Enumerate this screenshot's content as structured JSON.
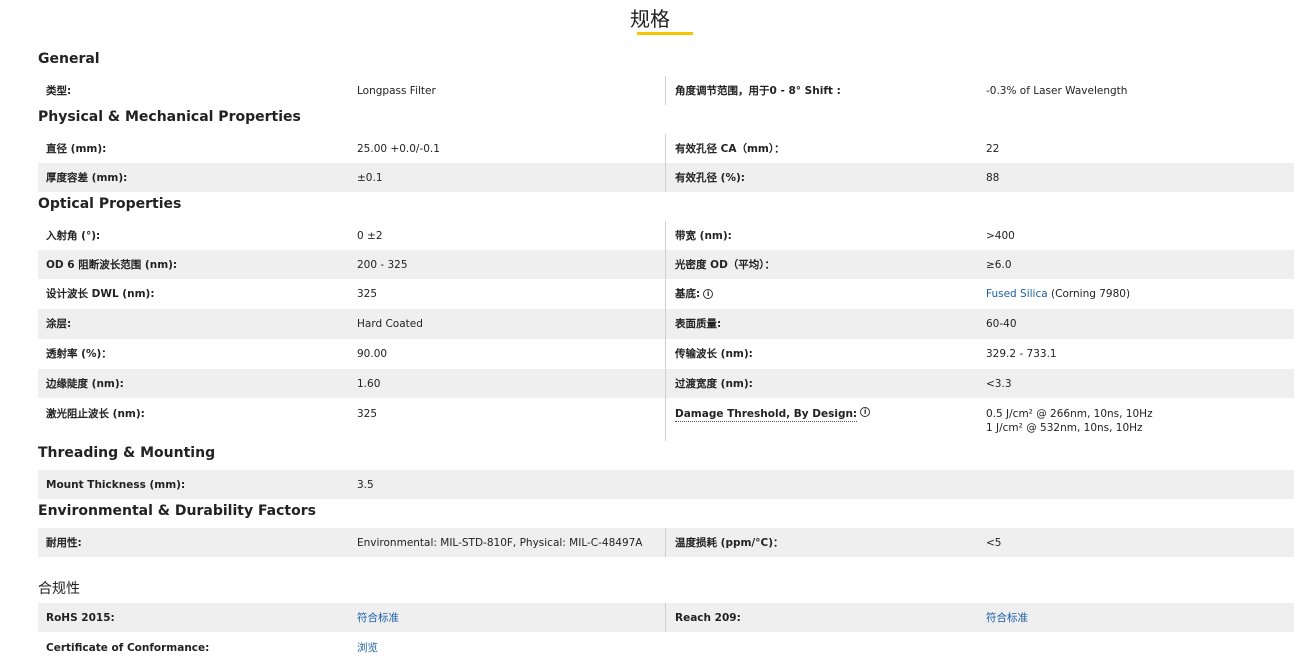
{
  "header": {
    "title": "规格"
  },
  "sections": {
    "general": "General",
    "physical": "Physical & Mechanical Properties",
    "optical": "Optical Properties",
    "threading": "Threading & Mounting",
    "environmental": "Environmental & Durability Factors",
    "compliance": "合规性"
  },
  "general": {
    "type_label": "类型:",
    "type_value": "Longpass Filter",
    "shift_label": "角度调节范围，用于0 - 8° Shift :",
    "shift_value": "-0.3% of Laser Wavelength"
  },
  "physical": {
    "diameter_label": "直径 (mm):",
    "diameter_value": "25.00 +0.0/-0.1",
    "ca_label": "有效孔径 CA（mm）：",
    "ca_value": "22",
    "thickness_tol_label": "厚度容差 (mm):",
    "thickness_tol_value": "±0.1",
    "ca_pct_label": "有效孔径 (%):",
    "ca_pct_value": "88"
  },
  "optical": {
    "aoi_label": "入射角 (°):",
    "aoi_value": "0 ±2",
    "bandwidth_label": "带宽 (nm):",
    "bandwidth_value": ">400",
    "od_range_label": "OD 6 阻断波长范围 (nm):",
    "od_range_value": "200 - 325",
    "od_label": "光密度 OD（平均）：",
    "od_value": "≥6.0",
    "dwl_label": "设计波长 DWL (nm):",
    "dwl_value": "325",
    "substrate_label": "基底:",
    "substrate_link": "Fused Silica",
    "substrate_rest": " (Corning 7980)",
    "coating_label": "涂层:",
    "coating_value": "Hard Coated",
    "surface_label": "表面质量:",
    "surface_value": "60-40",
    "trans_label": "透射率 (%)：",
    "trans_value": "90.00",
    "trans_wl_label": "传输波长 (nm):",
    "trans_wl_value": "329.2 - 733.1",
    "edge_label": "边缘陡度 (nm):",
    "edge_value": "1.60",
    "transition_label": "过渡宽度 (nm):",
    "transition_value": "<3.3",
    "blocking_label": "激光阻止波长 (nm):",
    "blocking_value": "325",
    "damage_label": "Damage Threshold, By Design:",
    "damage_value_1": "0.5 J/cm² @ 266nm, 10ns, 10Hz",
    "damage_value_2": "1 J/cm² @ 532nm, 10ns, 10Hz",
    "info_glyph": "i"
  },
  "threading": {
    "mount_label": "Mount Thickness (mm):",
    "mount_value": "3.5"
  },
  "environmental": {
    "durability_label": "耐用性:",
    "durability_value": "Environmental: MIL-STD-810F, Physical: MIL-C-48497A",
    "temp_label": "温度损耗 (ppm/°C)：",
    "temp_value": "<5"
  },
  "compliance": {
    "rohs_label": "RoHS 2015:",
    "rohs_value": "符合标准",
    "reach_label": "Reach 209:",
    "reach_value": "符合标准",
    "cert_label": "Certificate of Conformance:",
    "cert_value": "浏览"
  },
  "colors": {
    "accent": "#f5c400",
    "row_shade": "#efefef",
    "link": "#1a5fa8"
  }
}
